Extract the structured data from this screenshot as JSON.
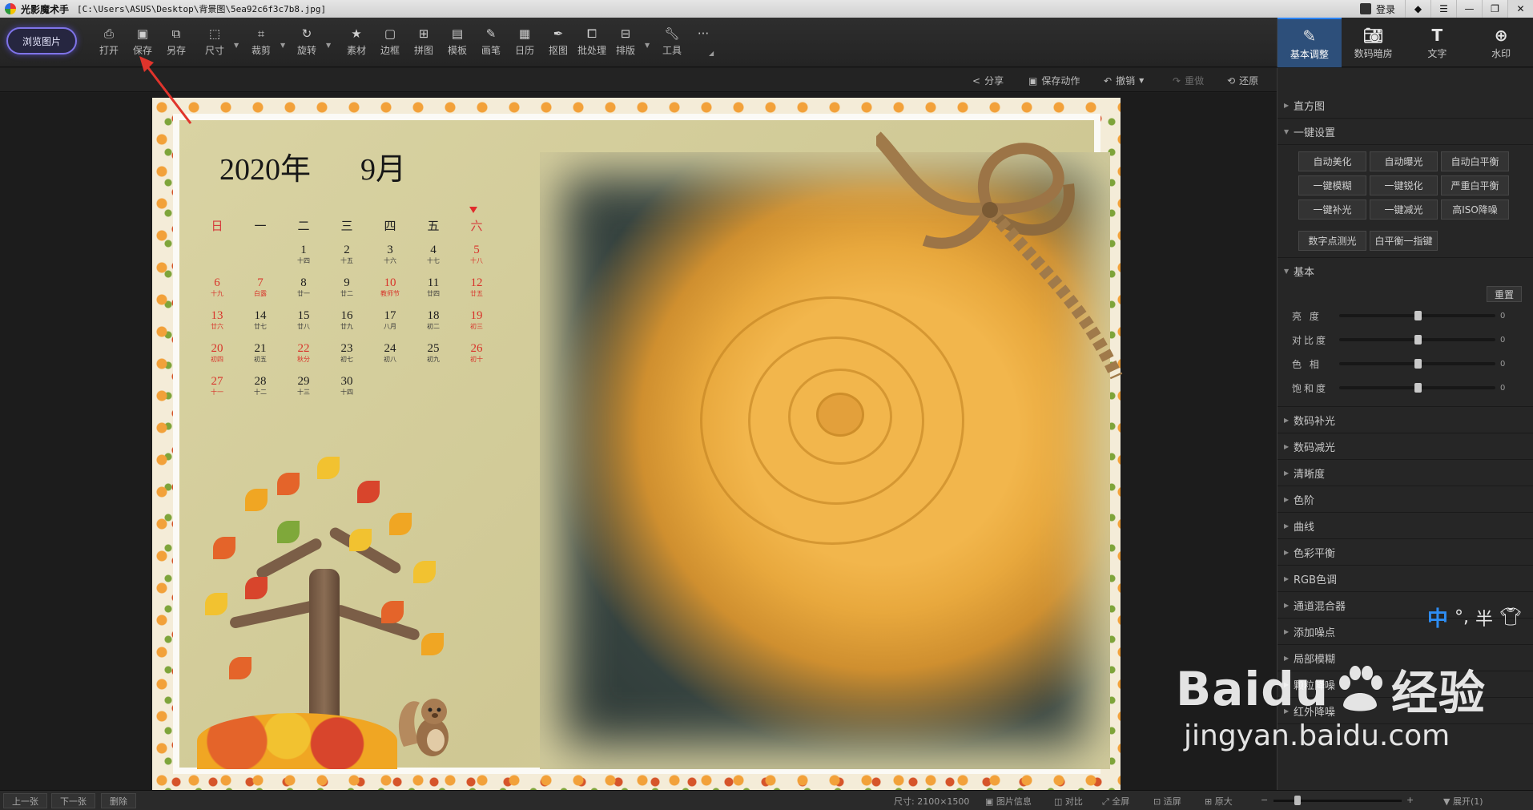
{
  "window": {
    "app_name": "光影魔术手",
    "file_path": "[C:\\Users\\ASUS\\Desktop\\背景图\\5ea92c6f3c7b8.jpg]",
    "login_label": "登录"
  },
  "toolbar": {
    "browse": "浏览图片",
    "tools": [
      "打开",
      "保存",
      "另存",
      "尺寸",
      "裁剪",
      "旋转",
      "素材",
      "边框",
      "拼图",
      "模板",
      "画笔",
      "日历",
      "抠图",
      "批处理",
      "排版",
      "工具"
    ],
    "more": "···"
  },
  "right_tabs": [
    "基本调整",
    "数码暗房",
    "文字",
    "水印"
  ],
  "subbar": {
    "share": "分享",
    "save_action": "保存动作",
    "undo": "撤销",
    "redo": "重做",
    "restore": "还原"
  },
  "calendar": {
    "year": "2020年",
    "month": "9月",
    "weekdays": [
      "日",
      "一",
      "二",
      "三",
      "四",
      "五",
      "六"
    ],
    "days": [
      {
        "n": "",
        "l": ""
      },
      {
        "n": "",
        "l": ""
      },
      {
        "n": "1",
        "l": "十四"
      },
      {
        "n": "2",
        "l": "十五"
      },
      {
        "n": "3",
        "l": "十六"
      },
      {
        "n": "4",
        "l": "十七"
      },
      {
        "n": "5",
        "l": "十八"
      },
      {
        "n": "6",
        "l": "十九"
      },
      {
        "n": "7",
        "l": "白露"
      },
      {
        "n": "8",
        "l": "廿一"
      },
      {
        "n": "9",
        "l": "廿二"
      },
      {
        "n": "10",
        "l": "教师节"
      },
      {
        "n": "11",
        "l": "廿四"
      },
      {
        "n": "12",
        "l": "廿五"
      },
      {
        "n": "13",
        "l": "廿六"
      },
      {
        "n": "14",
        "l": "廿七"
      },
      {
        "n": "15",
        "l": "廿八"
      },
      {
        "n": "16",
        "l": "廿九"
      },
      {
        "n": "17",
        "l": "八月"
      },
      {
        "n": "18",
        "l": "初二"
      },
      {
        "n": "19",
        "l": "初三"
      },
      {
        "n": "20",
        "l": "初四"
      },
      {
        "n": "21",
        "l": "初五"
      },
      {
        "n": "22",
        "l": "秋分"
      },
      {
        "n": "23",
        "l": "初七"
      },
      {
        "n": "24",
        "l": "初八"
      },
      {
        "n": "25",
        "l": "初九"
      },
      {
        "n": "26",
        "l": "初十"
      },
      {
        "n": "27",
        "l": "十一"
      },
      {
        "n": "28",
        "l": "十二"
      },
      {
        "n": "29",
        "l": "十三"
      },
      {
        "n": "30",
        "l": "十四"
      }
    ],
    "red_days": [
      "5",
      "6",
      "7",
      "10",
      "12",
      "13",
      "19",
      "20",
      "22",
      "26",
      "27"
    ]
  },
  "panel": {
    "histogram": "直方图",
    "one_click": "一键设置",
    "one_click_buttons": [
      "自动美化",
      "自动曝光",
      "自动白平衡",
      "一键模糊",
      "一键锐化",
      "严重白平衡",
      "一键补光",
      "一键减光",
      "高ISO降噪"
    ],
    "extra_buttons": [
      "数字点测光",
      "白平衡一指键"
    ],
    "basic": "基本",
    "reset": "重置",
    "sliders": [
      {
        "label": "亮 度",
        "value": 0,
        "position": 0.5
      },
      {
        "label": "对比度",
        "value": 0,
        "position": 0.5
      },
      {
        "label": "色 相",
        "value": 0,
        "position": 0.5
      },
      {
        "label": "饱和度",
        "value": 0,
        "position": 0.5
      }
    ],
    "sections": [
      "数码补光",
      "数码减光",
      "清晰度",
      "色阶",
      "曲线",
      "色彩平衡",
      "RGB色调",
      "通道混合器",
      "添加噪点",
      "局部模糊",
      "颗粒降噪",
      "红外降噪"
    ]
  },
  "ime": {
    "zh": "中",
    "punct": "°,",
    "half": "半"
  },
  "watermark": {
    "brand": "Baidu",
    "cn": "经验",
    "url": "jingyan.baidu.com"
  },
  "status": {
    "prev": "上一张",
    "next": "下一张",
    "delete": "删除",
    "size_label": "尺寸: 2100×1500",
    "info": "图片信息",
    "compare": "对比",
    "fullscreen": "全屏",
    "fit": "适屏",
    "original": "原大",
    "expand": "展开(1)"
  },
  "colors": {
    "accent": "#2a84ff",
    "browse_border": "#7f74e8",
    "holiday_red": "#d8342b",
    "arrow_red": "#e0342c"
  }
}
